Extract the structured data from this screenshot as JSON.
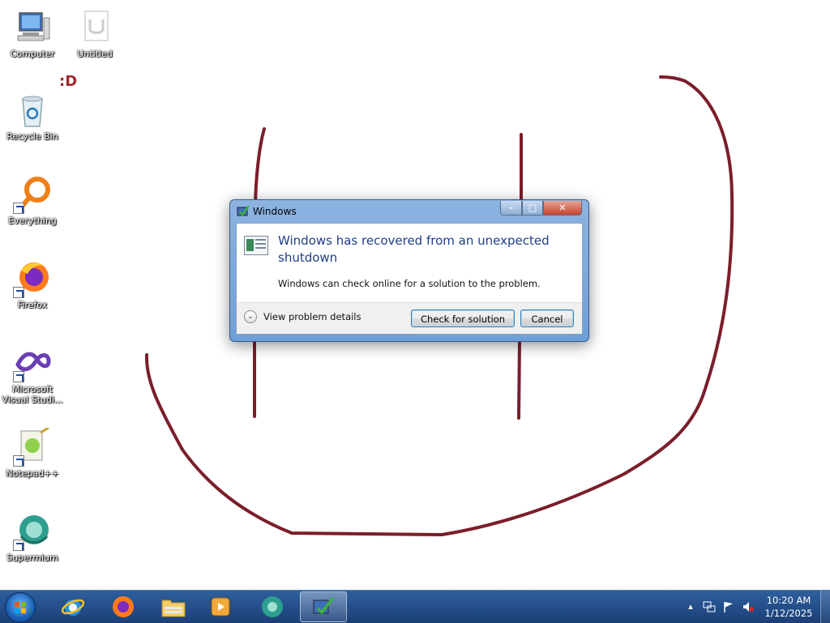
{
  "desktop": {
    "annotation": ":D",
    "icons": [
      {
        "name": "computer",
        "label": "Computer"
      },
      {
        "name": "untitled",
        "label": "Untitled"
      },
      {
        "name": "recycle-bin",
        "label": "Recycle Bin"
      },
      {
        "name": "everything",
        "label": "Everything"
      },
      {
        "name": "firefox",
        "label": "Firefox"
      },
      {
        "name": "visual-studio",
        "label": "Microsoft Visual Studi..."
      },
      {
        "name": "notepad-plus-plus",
        "label": "Notepad++"
      },
      {
        "name": "supermium",
        "label": "Supermium"
      }
    ],
    "drawing_color": "#7b1e2b"
  },
  "dialog": {
    "title": "Windows",
    "heading": "Windows has recovered from an unexpected shutdown",
    "message": "Windows can check online for a solution to the problem.",
    "details_label": "View problem details",
    "primary_button": "Check for solution",
    "cancel_button": "Cancel"
  },
  "taskbar": {
    "pinned": [
      "internet-explorer",
      "firefox",
      "file-explorer",
      "media-player",
      "supermium",
      "problem-reporting"
    ],
    "tray": {
      "icons": [
        "show-hidden-icons-arrow",
        "network-icon",
        "action-center-flag-icon",
        "volume-muted-icon"
      ]
    },
    "clock": {
      "time": "10:20 AM",
      "date": "1/12/2025"
    }
  }
}
